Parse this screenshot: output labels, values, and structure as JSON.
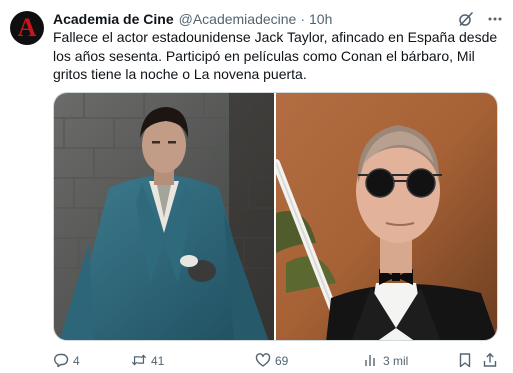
{
  "account": {
    "name": "Academia de Cine",
    "handle": "@Academiadecine",
    "separator": "·",
    "time": "10h",
    "avatar_letter": "A",
    "avatar_colors": {
      "background": "#0f0f0f",
      "letter": "#c4161c"
    }
  },
  "tweet": {
    "text": "Fallece el actor estadounidense Jack Taylor, afincado en España desde los años sesenta. Participó en películas como Conan el bárbaro, Mil gritos tiene la noche o La novena puerta."
  },
  "media": {
    "left_photo": "Man in teal Victorian cape and coat against stone wall",
    "right_photo": "Man in round dark sunglasses with tuxedo and bow tie"
  },
  "actions": {
    "reply_count": "4",
    "retweet_count": "41",
    "like_count": "69",
    "views_count": "3 mil"
  },
  "icons": {
    "grok": "grok-slash-icon",
    "more": "more-horizontal-icon",
    "reply": "reply-icon",
    "retweet": "retweet-icon",
    "like": "heart-icon",
    "views": "views-chart-icon",
    "bookmark": "bookmark-icon",
    "share": "share-icon"
  },
  "colors": {
    "text_primary": "#0f1419",
    "text_secondary": "#536471",
    "border": "#cfd9de"
  }
}
